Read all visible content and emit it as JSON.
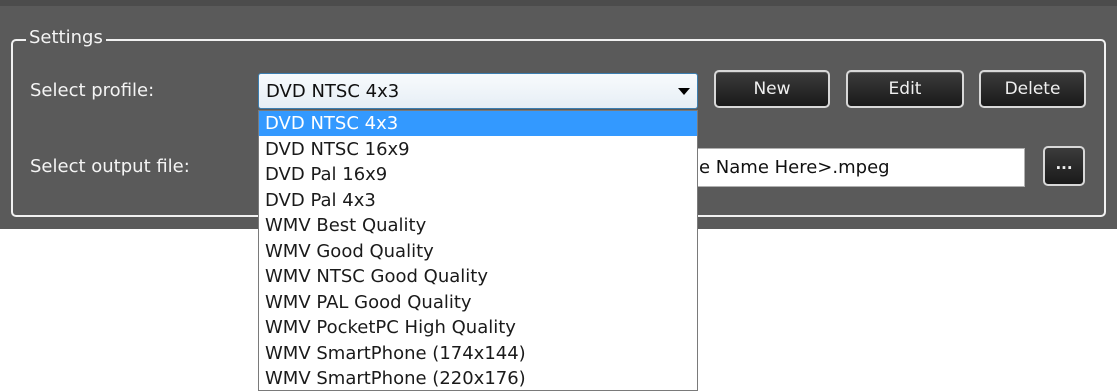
{
  "settings": {
    "group_title": "Settings",
    "profile_label": "Select profile:",
    "selected_profile": "DVD NTSC 4x3",
    "output_label": "Select output file:",
    "output_value_visible": "e Name Here>.mpeg",
    "buttons": {
      "new": "New",
      "edit": "Edit",
      "delete": "Delete",
      "browse": "..."
    },
    "dropdown_options": [
      "DVD NTSC 4x3",
      "DVD NTSC 16x9",
      "DVD Pal 16x9",
      "DVD Pal 4x3",
      "WMV Best Quality",
      "WMV Good Quality",
      "WMV NTSC Good Quality",
      "WMV PAL Good Quality",
      "WMV PocketPC High Quality",
      "WMV SmartPhone (174x144)",
      "WMV SmartPhone (220x176)"
    ],
    "highlighted_option": "DVD NTSC 4x3"
  },
  "colors": {
    "panel": "#5a5a5a",
    "highlight": "#3399ff",
    "text_light": "#f4f4f4"
  },
  "icons": {
    "dropdown_arrow": "chevron-down-icon"
  }
}
